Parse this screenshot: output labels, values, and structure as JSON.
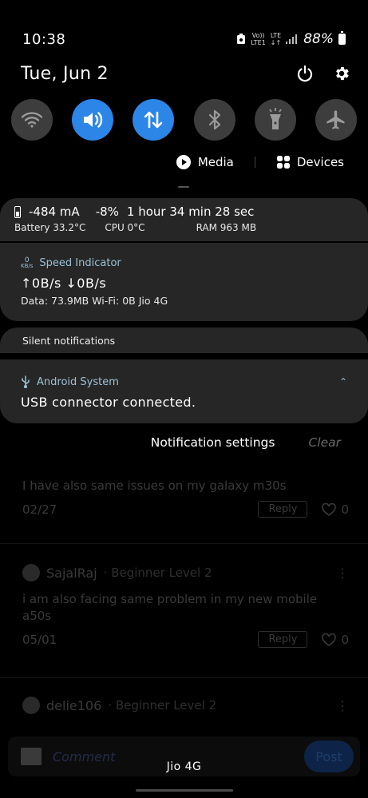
{
  "status_bar": {
    "time": "10:38",
    "volte_top": "Vo))",
    "volte_bottom": "LTE1",
    "lte_top": "LTE",
    "lte_bottom": "↓↑",
    "battery_percent": "88%"
  },
  "header": {
    "date": "Tue, Jun 2",
    "power_icon": "power-icon",
    "settings_icon": "gear-icon"
  },
  "quick_settings": [
    {
      "name": "wifi",
      "icon": "wifi-icon",
      "active": false
    },
    {
      "name": "sound",
      "icon": "volume-icon",
      "active": true
    },
    {
      "name": "mobile-data",
      "icon": "data-arrows-icon",
      "active": true
    },
    {
      "name": "bluetooth",
      "icon": "bluetooth-icon",
      "active": false
    },
    {
      "name": "flashlight",
      "icon": "flashlight-icon",
      "active": false
    },
    {
      "name": "airplane",
      "icon": "airplane-icon",
      "active": false
    }
  ],
  "media_row": {
    "media_label": "Media",
    "devices_label": "Devices"
  },
  "battery_card": {
    "current": "-484 mA",
    "percent_change": "-8%",
    "time_remaining": "1 hour 34 min 28 sec",
    "battery_temp": "Battery  33.2°C",
    "cpu_temp": "CPU  0°C",
    "ram": "RAM  963 MB"
  },
  "speed_card": {
    "icon_top": "0",
    "icon_bottom": "KB/s",
    "app_name": "Speed Indicator",
    "rates": "↑0B/s ↓0B/s",
    "data": "Data: 73.9MB Wi-Fi: 0B  Jio 4G"
  },
  "silent_section": {
    "label": "Silent notifications"
  },
  "android_card": {
    "app_name": "Android System",
    "message": "USB connector connected.",
    "expand_icon": "chevron-up-icon"
  },
  "notification_actions": {
    "settings_label": "Notification settings",
    "clear_label": "Clear"
  },
  "background_page": {
    "comment1": {
      "text": "I have also same issues on my galaxy m30s",
      "date": "02/27",
      "reply_label": "Reply",
      "likes": "0"
    },
    "comment2": {
      "user": "SajalRaj",
      "level": "· Beginner Level 2",
      "text": "i am also facing same problem in my new mobile a50s",
      "date": "05/01",
      "reply_label": "Reply",
      "likes": "0"
    },
    "comment3": {
      "user": "delie106",
      "level": "· Beginner Level 2"
    },
    "compose_placeholder": "Comment",
    "post_label": "Post"
  },
  "carrier": "Jio 4G",
  "colors": {
    "accent": "#2b86e8",
    "card": "#262626",
    "app_label": "#9cc0d6"
  }
}
